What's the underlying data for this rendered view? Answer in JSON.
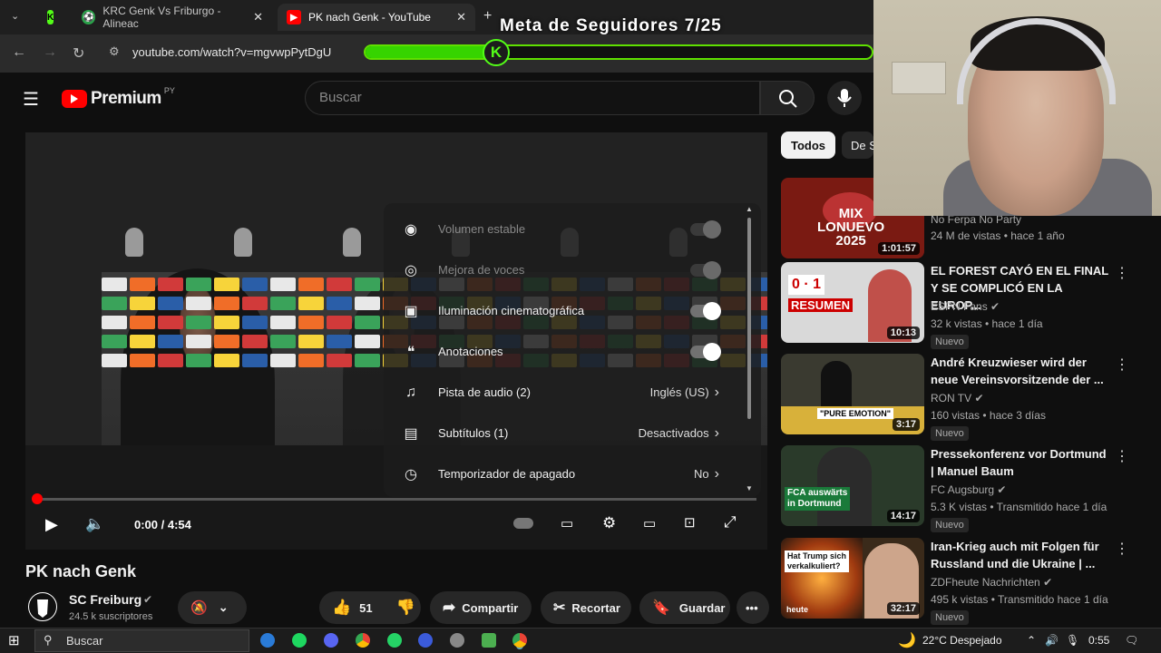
{
  "browser": {
    "tabs": [
      {
        "title": "",
        "icon": "kick-icon"
      },
      {
        "title": "KRC Genk Vs Friburgo - Alineac",
        "icon": "soccer-ball-icon"
      },
      {
        "title": "PK nach Genk - YouTube",
        "icon": "youtube-icon"
      }
    ],
    "url": "youtube.com/watch?v=mgvwpPytDgU"
  },
  "overlay": {
    "goal_text": "Meta de Seguidores 7/25",
    "goal_progress": 0.28,
    "kick_letter": "K"
  },
  "youtube": {
    "logo_text": "Premium",
    "region": "PY",
    "search_placeholder": "Buscar"
  },
  "player": {
    "time": "0:00 / 4:54",
    "settings": [
      {
        "label": "Volumen estable",
        "type": "toggle",
        "on": true,
        "disabled": true,
        "icon": "stable-volume-icon"
      },
      {
        "label": "Mejora de voces",
        "type": "toggle",
        "on": true,
        "disabled": true,
        "icon": "voice-boost-icon"
      },
      {
        "label": "Iluminación cinematográfica",
        "type": "toggle",
        "on": true,
        "disabled": false,
        "icon": "ambient-mode-icon"
      },
      {
        "label": "Anotaciones",
        "type": "toggle",
        "on": true,
        "disabled": false,
        "icon": "annotations-icon"
      },
      {
        "label": "Pista de audio (2)",
        "value": "Inglés (US)",
        "icon": "audio-track-icon"
      },
      {
        "label": "Subtítulos (1)",
        "value": "Desactivados",
        "icon": "subtitles-icon"
      },
      {
        "label": "Temporizador de apagado",
        "value": "No",
        "icon": "sleep-timer-icon"
      }
    ]
  },
  "video": {
    "title": "PK nach Genk",
    "channel": "SC Freiburg",
    "subscribers": "24.5 k suscriptores",
    "likes": "51",
    "share_label": "Compartir",
    "clip_label": "Recortar",
    "save_label": "Guardar"
  },
  "chips": [
    "Todos",
    "De S"
  ],
  "recommendations": [
    {
      "title": "",
      "channel": "No Ferpa No Party",
      "meta": "24 M de vistas • hace 1 año",
      "duration": "1:01:57",
      "badge": "",
      "thumb_color": "#7a1a12"
    },
    {
      "title": "EL FOREST CAYÓ EN EL FINAL Y SE COMPLICÓ EN LA EUROP...",
      "channel": "ESPN Fans",
      "meta": "32 k vistas • hace 1 día",
      "duration": "10:13",
      "badge": "Nuevo",
      "thumb_color": "#d9d9d9"
    },
    {
      "title": "André Kreuzwieser wird der neue Vereinsvorsitzende der ...",
      "channel": "RON TV",
      "meta": "160 vistas • hace 3 días",
      "duration": "3:17",
      "badge": "Nuevo",
      "thumb_color": "#3a3a30"
    },
    {
      "title": "Pressekonferenz vor Dortmund | Manuel Baum",
      "channel": "FC Augsburg",
      "meta": "5.3 K vistas • Transmitido hace 1 día",
      "duration": "14:17",
      "badge": "Nuevo",
      "thumb_color": "#2a3a2a"
    },
    {
      "title": "Iran-Krieg auch mit Folgen für Russland und die Ukraine | ...",
      "channel": "ZDFheute Nachrichten",
      "meta": "495 k vistas • Transmitido hace 1 día",
      "duration": "32:17",
      "badge": "Nuevo",
      "thumb_color": "#3a2a1a"
    }
  ],
  "thumb_texts": {
    "mix": "MIX\nLONUEVO\n2025",
    "score": "0 · 1",
    "resumen": "RESUMEN",
    "pure": "\"PURE EMOTION\"",
    "fca": "FCA auswärts\nin Dortmund",
    "trump": "Hat Trump sich\nverkalkuliert?",
    "heute": "heute"
  },
  "taskbar": {
    "search_placeholder": "Buscar",
    "weather": "22°C  Despejado",
    "clock": "0:55"
  }
}
